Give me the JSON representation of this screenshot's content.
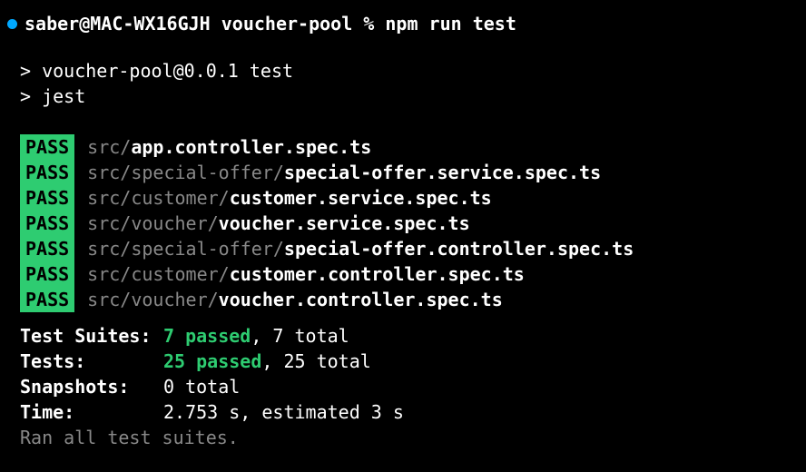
{
  "prompt": {
    "user_host": "saber@MAC-WX16GJH",
    "dir": "voucher-pool",
    "symbol": "%",
    "command": "npm run test"
  },
  "npm_output": {
    "line1": "> voucher-pool@0.0.1 test",
    "line2": "> jest"
  },
  "pass_label": "PASS",
  "results": [
    {
      "path": "src/",
      "file": "app.controller.spec.ts"
    },
    {
      "path": "src/special-offer/",
      "file": "special-offer.service.spec.ts"
    },
    {
      "path": "src/customer/",
      "file": "customer.service.spec.ts"
    },
    {
      "path": "src/voucher/",
      "file": "voucher.service.spec.ts"
    },
    {
      "path": "src/special-offer/",
      "file": "special-offer.controller.spec.ts"
    },
    {
      "path": "src/customer/",
      "file": "customer.controller.spec.ts"
    },
    {
      "path": "src/voucher/",
      "file": "voucher.controller.spec.ts"
    }
  ],
  "summary": {
    "suites_label": "Test Suites:",
    "suites_passed": "7 passed",
    "suites_total": ", 7 total",
    "tests_label": "Tests:",
    "tests_passed": "25 passed",
    "tests_total": ", 25 total",
    "snapshots_label": "Snapshots:",
    "snapshots_value": "0 total",
    "time_label": "Time:",
    "time_value": "2.753 s, estimated 3 s"
  },
  "ran": "Ran all test suites.",
  "partial_next": "     "
}
